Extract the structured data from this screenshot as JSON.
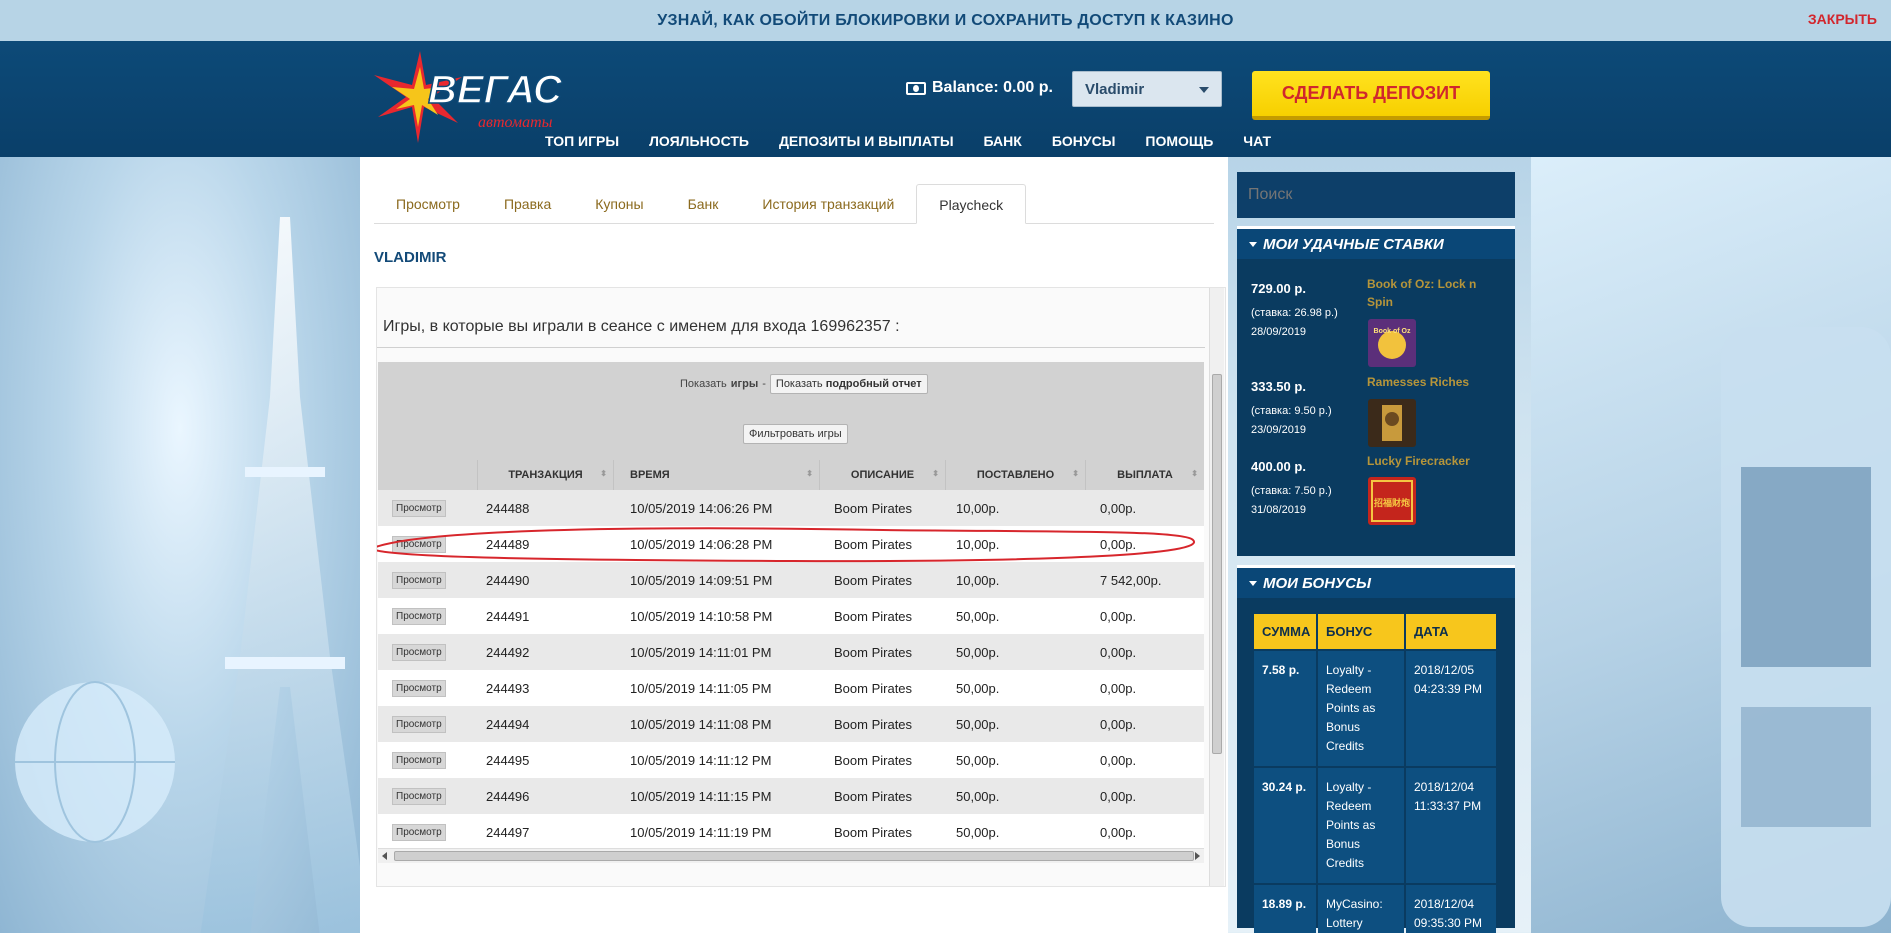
{
  "announce": {
    "text": "УЗНАЙ, КАК ОБОЙТИ БЛОКИРОВКИ И СОХРАНИТЬ ДОСТУП К КАЗИНО",
    "close": "ЗАКРЫТЬ"
  },
  "header": {
    "logo_main": "ВЕГАС",
    "logo_sub": "автоматы",
    "balance": "Balance: 0.00 р.",
    "user": "Vladimir",
    "deposit": "СДЕЛАТЬ ДЕПОЗИТ",
    "nav": [
      "ТОП ИГРЫ",
      "ЛОЯЛЬНОСТЬ",
      "ДЕПОЗИТЫ И ВЫПЛАТЫ",
      "БАНК",
      "БОНУСЫ",
      "ПОМОЩЬ",
      "ЧАТ"
    ]
  },
  "tabs": [
    "Просмотр",
    "Правка",
    "Купоны",
    "Банк",
    "История транзакций",
    "Playcheck"
  ],
  "user_heading": "VLADIMIR",
  "playcheck": {
    "title": "Игры, в которые вы играли в сеансе с именем для входа 169962357 :",
    "show_prefix": "Показать",
    "show_bold": "игры",
    "show_dash": "-",
    "report_btn_prefix": "Показать",
    "report_btn_bold": "подробный отчет",
    "filter_btn": "Фильтровать игры",
    "columns": [
      "",
      "ТРАНЗАКЦИЯ",
      "ВРЕМЯ",
      "ОПИСАНИЕ",
      "ПОСТАВЛЕНО",
      "ВЫПЛАТА"
    ],
    "view_label": "Просмотр",
    "rows": [
      [
        "244488",
        "10/05/2019 14:06:26 PM",
        "Boom Pirates",
        "10,00р.",
        "0,00р."
      ],
      [
        "244489",
        "10/05/2019 14:06:28 PM",
        "Boom Pirates",
        "10,00р.",
        "0,00р."
      ],
      [
        "244490",
        "10/05/2019 14:09:51 PM",
        "Boom Pirates",
        "10,00р.",
        "7 542,00р."
      ],
      [
        "244491",
        "10/05/2019 14:10:58 PM",
        "Boom Pirates",
        "50,00р.",
        "0,00р."
      ],
      [
        "244492",
        "10/05/2019 14:11:01 PM",
        "Boom Pirates",
        "50,00р.",
        "0,00р."
      ],
      [
        "244493",
        "10/05/2019 14:11:05 PM",
        "Boom Pirates",
        "50,00р.",
        "0,00р."
      ],
      [
        "244494",
        "10/05/2019 14:11:08 PM",
        "Boom Pirates",
        "50,00р.",
        "0,00р."
      ],
      [
        "244495",
        "10/05/2019 14:11:12 PM",
        "Boom Pirates",
        "50,00р.",
        "0,00р."
      ],
      [
        "244496",
        "10/05/2019 14:11:15 PM",
        "Boom Pirates",
        "50,00р.",
        "0,00р."
      ],
      [
        "244497",
        "10/05/2019 14:11:19 PM",
        "Boom Pirates",
        "50,00р.",
        "0,00р."
      ]
    ]
  },
  "sidebar": {
    "search_placeholder": "Поиск",
    "wins_title": "МОИ УДАЧНЫЕ СТАВКИ",
    "wins": [
      {
        "amount": "729.00 р.",
        "detail": "(ставка: 26.98 р.) 28/09/2019",
        "game": "Book of Oz: Lock n Spin",
        "thumb_text": "Book of Oz"
      },
      {
        "amount": "333.50 р.",
        "detail": "(ставка: 9.50 р.) 23/09/2019",
        "game": "Ramesses Riches",
        "thumb_text": ""
      },
      {
        "amount": "400.00 р.",
        "detail": "(ставка: 7.50 р.) 31/08/2019",
        "game": "Lucky Firecracker",
        "thumb_text": "招福财炮"
      }
    ],
    "bonus_title": "МОИ БОНУСЫ",
    "bonus_cols": [
      "СУММА",
      "БОНУС",
      "ДАТА"
    ],
    "bonuses": [
      {
        "sum": "7.58 р.",
        "bonus": "Loyalty - Redeem Points as Bonus Credits",
        "date": "2018/12/05 04:23:39 PM"
      },
      {
        "sum": "30.24 р.",
        "bonus": "Loyalty - Redeem Points as Bonus Credits",
        "date": "2018/12/04 11:33:37 PM"
      },
      {
        "sum": "18.89 р.",
        "bonus": "MyCasino: Lottery",
        "date": "2018/12/04 09:35:30 PM"
      }
    ]
  },
  "colors": {
    "header_bg": "#0d4a78",
    "accent_yellow": "#f7d000",
    "accent_red": "#d2262d",
    "link_gold": "#8b6a1e"
  }
}
